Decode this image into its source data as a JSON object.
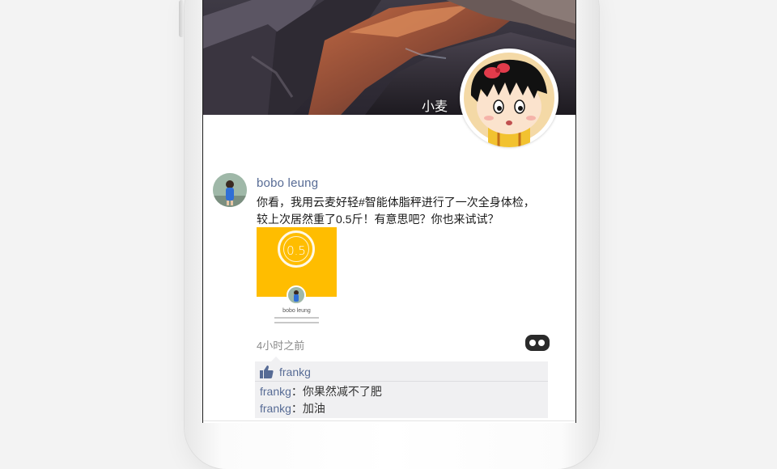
{
  "cover": {
    "display_name": "小麦"
  },
  "post": {
    "author": "bobo leung",
    "text_line1": "你看，我用云麦好轻#智能体脂秤进行了一次全身体检，",
    "text_line2": "较上次居然重了0.5斤！有意思吧？你也来试试？",
    "timestamp": "4小时之前",
    "image": {
      "value": "0.5",
      "name": "bobo leung"
    }
  },
  "likes": {
    "names": "frankg"
  },
  "comments": [
    {
      "name": "frankg",
      "separator": "：",
      "text": "你果然减不了肥"
    },
    {
      "name": "frankg",
      "separator": "：",
      "text": "加油"
    }
  ],
  "colors": {
    "link": "#576b95",
    "accent_yellow": "#ffbd00",
    "comment_bg": "#f0f0f2"
  },
  "icons": {
    "like": "thumbs-up-icon",
    "more": "more-dots-icon"
  }
}
